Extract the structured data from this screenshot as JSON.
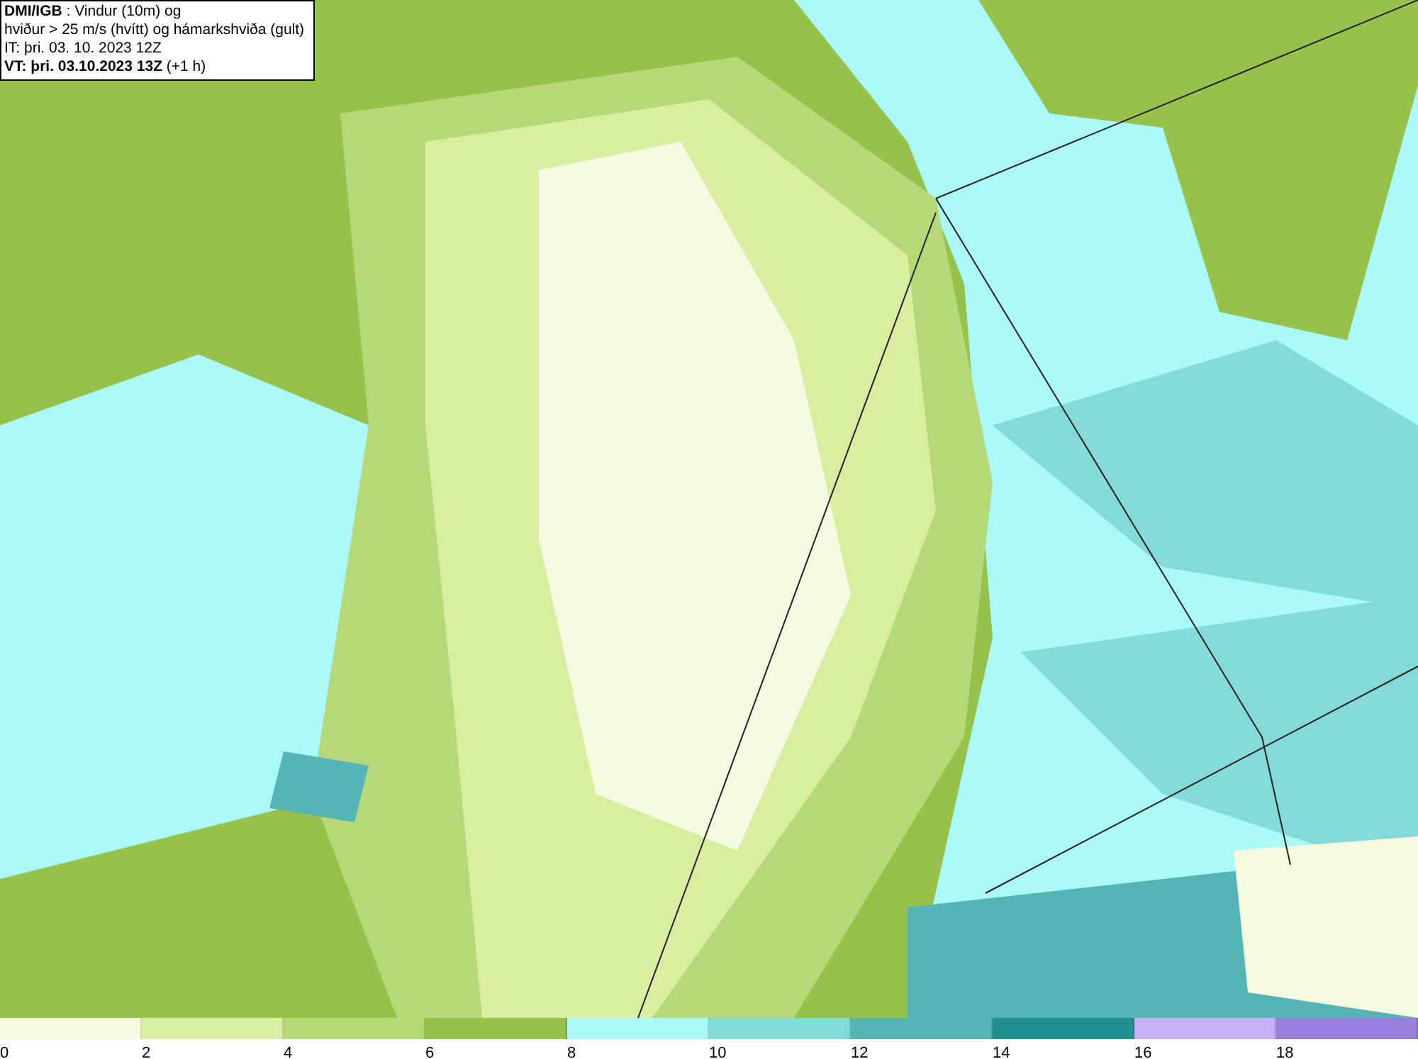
{
  "header": {
    "lines": [
      "**DMI/IGB** : Vindur (10m) og",
      "hviður > 25 m/s (hvítt) og hámarkshviða (gult)",
      "IT: þri. 03. 10. 2023 12Z",
      "**VT: þri. 03.10.2023 13Z** (+1 h)"
    ]
  },
  "legend": {
    "bins": [
      {
        "label": "0",
        "color": "#f5fbe0"
      },
      {
        "label": "2",
        "color": "#d8eda0"
      },
      {
        "label": "4",
        "color": "#b5d878"
      },
      {
        "label": "6",
        "color": "#96c14a"
      },
      {
        "label": "8",
        "color": "#aaf8f8"
      },
      {
        "label": "10",
        "color": "#84d9d9"
      },
      {
        "label": "12",
        "color": "#55b5b5"
      },
      {
        "label": "14",
        "color": "#239090"
      },
      {
        "label": "16",
        "color": "#c3b0f5"
      },
      {
        "label": "18",
        "color": "#9680dc"
      }
    ]
  }
}
